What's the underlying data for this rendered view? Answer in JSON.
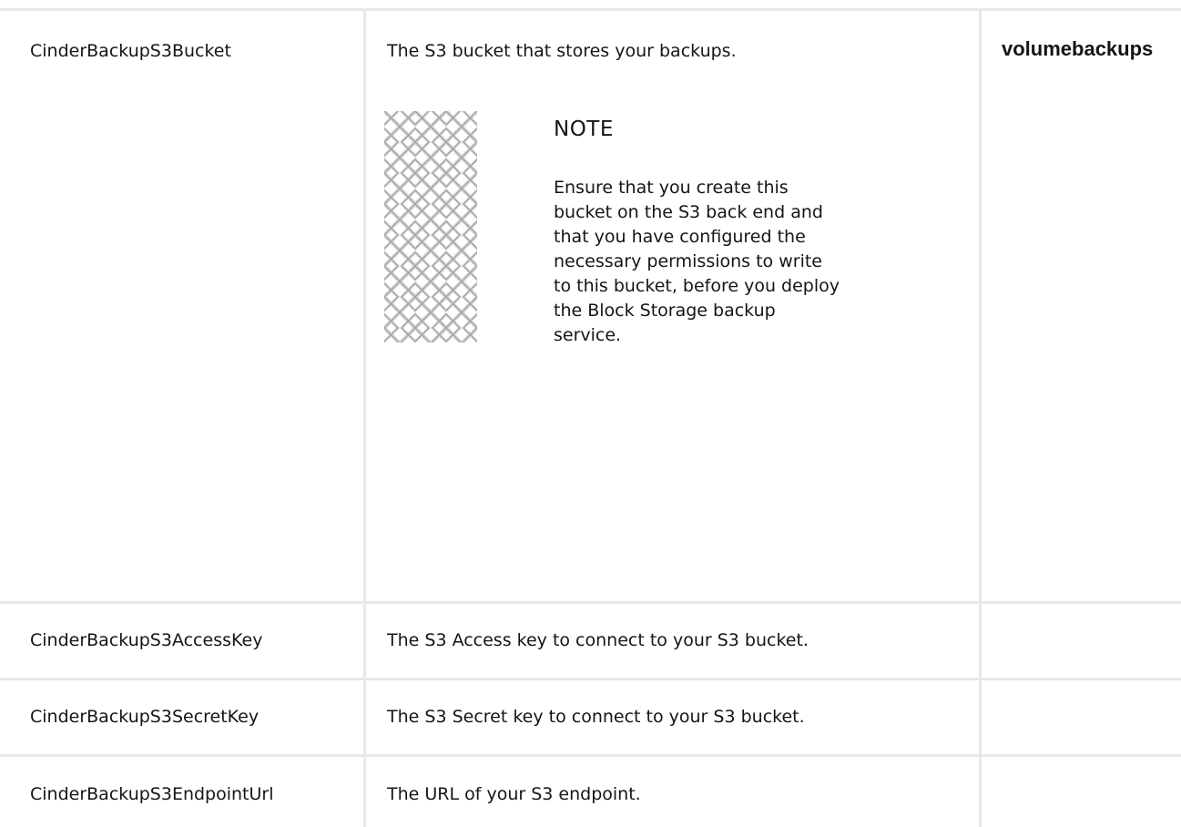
{
  "table": {
    "rows": [
      {
        "parameter": "CinderBackupS3Bucket",
        "description": "The S3 bucket that stores your backups.",
        "default": "volumebackups",
        "note": {
          "icon": "admonition-note-icon",
          "heading": "NOTE",
          "text": "Ensure that you create this bucket on the S3 back end and that you have configured the necessary permissions to write to this bucket, before you deploy the Block Storage backup service."
        }
      },
      {
        "parameter": "CinderBackupS3AccessKey",
        "description": "The S3 Access key to connect to your S3 bucket.",
        "default": ""
      },
      {
        "parameter": "CinderBackupS3SecretKey",
        "description": "The S3 Secret key to connect to your S3 bucket.",
        "default": ""
      },
      {
        "parameter": "CinderBackupS3EndpointUrl",
        "description": "The URL of your S3 endpoint.",
        "default": ""
      }
    ]
  }
}
